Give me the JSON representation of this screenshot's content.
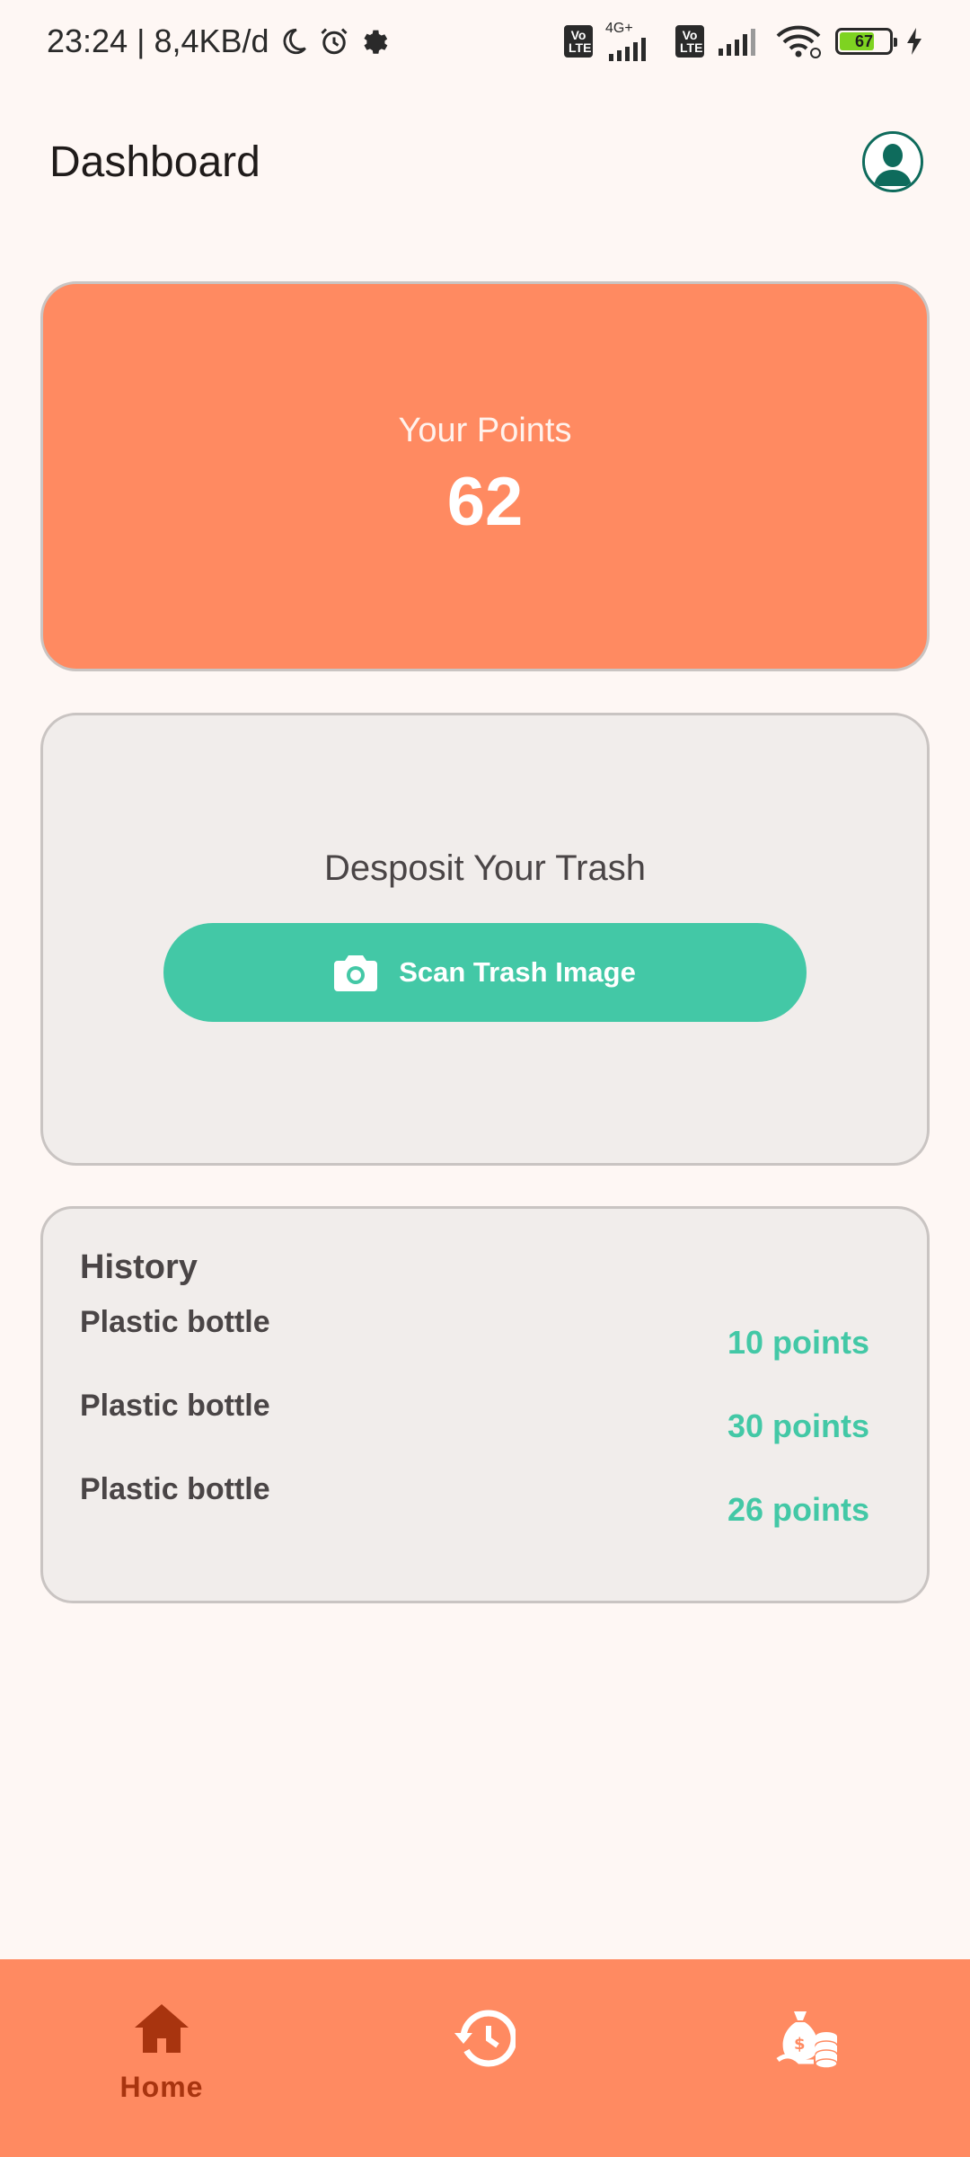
{
  "status_bar": {
    "time": "23:24",
    "separator": "|",
    "speed": "8,4KB/d",
    "network_label": "4G+",
    "volte_label": "Vo LTE",
    "battery_level": "67"
  },
  "app_bar": {
    "title": "Dashboard",
    "avatar_icon": "person-avatar-icon"
  },
  "points_card": {
    "label": "Your Points",
    "value": "62"
  },
  "deposit_card": {
    "title": "Desposit Your Trash",
    "scan_button_label": "Scan Trash Image",
    "scan_button_icon": "camera-icon"
  },
  "history": {
    "title": "History",
    "items": [
      {
        "name": "Plastic bottle",
        "points": "10 points"
      },
      {
        "name": "Plastic bottle",
        "points": "30 points"
      },
      {
        "name": "Plastic bottle",
        "points": "26 points"
      }
    ]
  },
  "bottom_nav": {
    "items": [
      {
        "label": "Home",
        "icon": "home-icon",
        "active": true
      },
      {
        "label": "",
        "icon": "history-icon",
        "active": false
      },
      {
        "label": "",
        "icon": "money-bag-coins-icon",
        "active": false
      }
    ]
  },
  "colors": {
    "accent": "#FF8A61",
    "primary_green": "#43C8A6",
    "card_bg": "#F1EDEB",
    "page_bg": "#FEF7F4",
    "nav_active": "#A8340F"
  }
}
